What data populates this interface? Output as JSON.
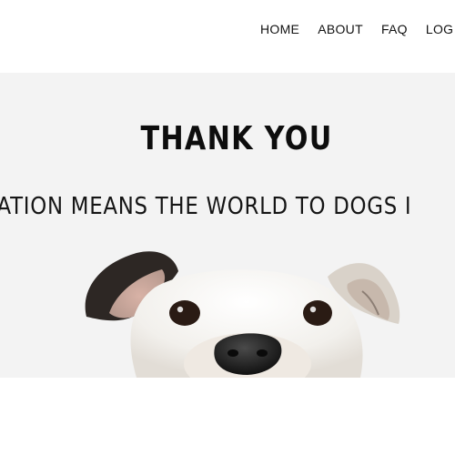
{
  "nav": {
    "items": [
      {
        "label": "HOME"
      },
      {
        "label": "ABOUT"
      },
      {
        "label": "FAQ"
      },
      {
        "label": "LOG"
      }
    ]
  },
  "hero": {
    "title": "THANK YOU",
    "subtitle": "ONATION MEANS THE WORLD TO DOGS I",
    "image_icon": "dog-photo"
  },
  "colors": {
    "background": "#ffffff",
    "hero_background": "#f3f3f3",
    "text": "#111111"
  }
}
